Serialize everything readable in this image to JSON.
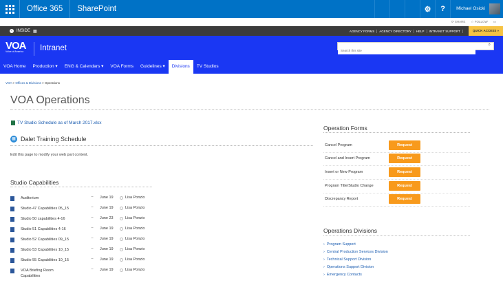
{
  "suite": {
    "brand": "Office 365",
    "app": "SharePoint",
    "user": "Michael Osicki",
    "share": "SHARE",
    "follow": "FOLLOW"
  },
  "topnav": {
    "inside": "INSIDE",
    "inside_badge": "▦",
    "links": [
      "AGENCY FORMS",
      "AGENCY DIRECTORY",
      "HELP",
      "INTRANET SUPPORT"
    ],
    "quick_access": "QUICK ACCESS »"
  },
  "header": {
    "logo": "VOA",
    "logo_sub": "Voice of America",
    "site_title": "Intranet",
    "search_placeholder": "Search this site"
  },
  "nav": [
    {
      "label": "VOA Home"
    },
    {
      "label": "Production ▾"
    },
    {
      "label": "ENG & Calendars ▾"
    },
    {
      "label": "VOA Forms"
    },
    {
      "label": "Guidelines ▾"
    },
    {
      "label": "Divisions"
    },
    {
      "label": "TV Studios"
    }
  ],
  "breadcrumb": {
    "root": "VOA",
    "mid": "Offices & Divisions",
    "current": "Operations"
  },
  "page": {
    "title": "VOA Operations",
    "xlsx_link": "TV Studio Schedule as of March 2017.xlsx",
    "dalet_heading": "Dalet Training Schedule",
    "edit_text": "Edit this page to modify your web part content."
  },
  "studio": {
    "heading": "Studio Capabilities",
    "rows": [
      {
        "name": "Auditorium",
        "date": "June 19",
        "by": "Lisa Ponzio"
      },
      {
        "name": "Studio 47 Capabilities 05_15",
        "date": "June 19",
        "by": "Lisa Ponzio"
      },
      {
        "name": "Studio 50 capabilities 4-16",
        "date": "June 23",
        "by": "Lisa Ponzio"
      },
      {
        "name": "Studio 51 Capabilities 4-16",
        "date": "June 19",
        "by": "Lisa Ponzio"
      },
      {
        "name": "Studio 52 Capabilities 09_15",
        "date": "June 19",
        "by": "Lisa Ponzio"
      },
      {
        "name": "Studio 53 Capabilities 10_15",
        "date": "June 19",
        "by": "Lisa Ponzio"
      },
      {
        "name": "Studio 55 Capabilities 10_15",
        "date": "June 19",
        "by": "Lisa Ponzio"
      },
      {
        "name": "VOA Briefing Room Capabilities",
        "date": "June 19",
        "by": "Lisa Ponzio"
      }
    ]
  },
  "operation_forms": {
    "heading": "Operation Forms",
    "button_label": "Request",
    "rows": [
      {
        "label": "Cancel Program"
      },
      {
        "label": "Cancel and Insert Program"
      },
      {
        "label": "Insert or New Program"
      },
      {
        "label": "Program Title/Studio Change"
      },
      {
        "label": "Discrepancy Report"
      }
    ]
  },
  "operations_divisions": {
    "heading": "Operations Divisions",
    "links": [
      "Program Support",
      "Central Production Services Division",
      "Technical Support Division",
      "Operations Support Division",
      "Emergency Contacts"
    ]
  },
  "colors": {
    "suite_blue": "#0072c6",
    "voa_blue": "#1a37f3",
    "request_orange": "#f89a1c",
    "quick_access_yellow": "#f6c343"
  }
}
